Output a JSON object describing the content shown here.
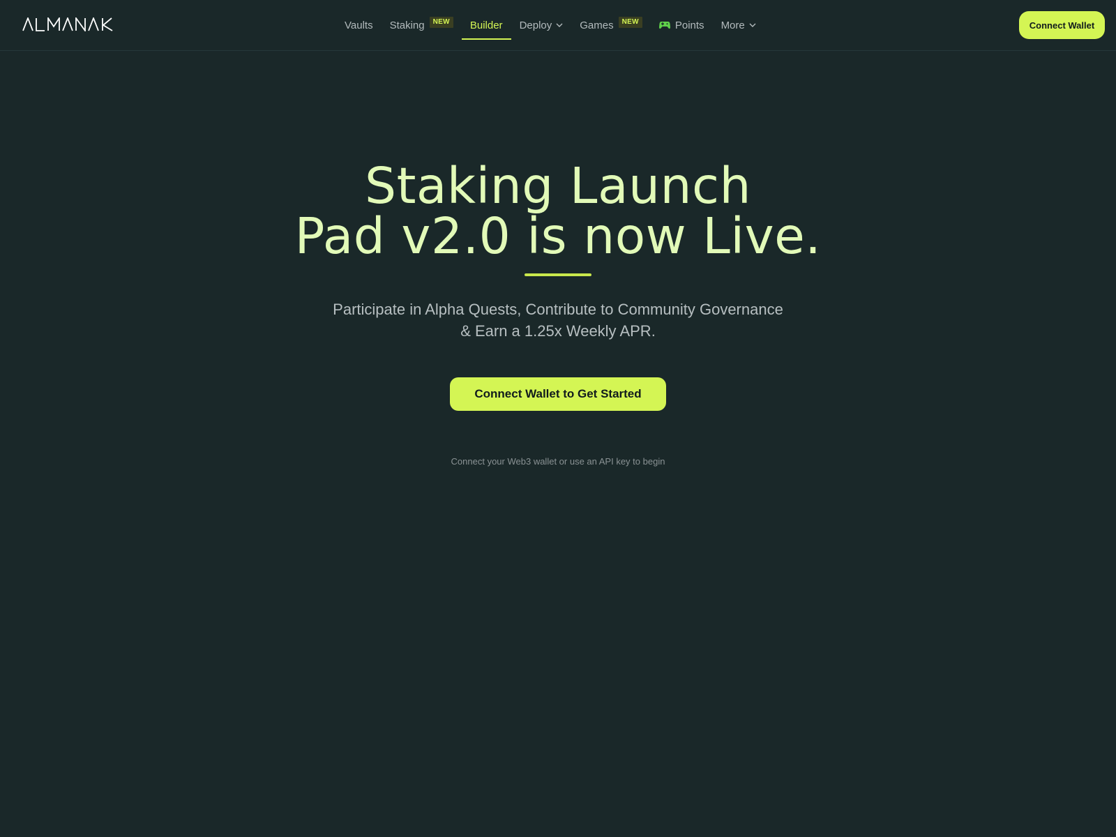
{
  "brand": {
    "logo_text": "ALMANAK",
    "accent_color": "#d4f554",
    "background_color": "#1a2829"
  },
  "nav": {
    "items": [
      {
        "label": "Vaults",
        "active": false
      },
      {
        "label": "Staking",
        "badge": "NEW",
        "active": false
      },
      {
        "label": "Builder",
        "active": true
      },
      {
        "label": "Deploy",
        "icon": "chevron-down-icon",
        "active": false
      },
      {
        "label": "Games",
        "badge": "NEW",
        "active": false
      },
      {
        "label": "Points",
        "icon": "gamepad-icon",
        "active": false
      },
      {
        "label": "More",
        "icon": "chevron-down-icon",
        "active": false
      }
    ],
    "connect_wallet_label": "Connect Wallet"
  },
  "hero": {
    "title_line1": "Staking Launch",
    "title_line2": "Pad v2.0 is now Live.",
    "subtitle_line1": "Participate in Alpha Quests, Contribute to Community Governance",
    "subtitle_line2": "& Earn a 1.25x Weekly APR.",
    "cta_label": "Connect Wallet to Get Started",
    "hint": "Connect your Web3 wallet or use an API key to begin"
  }
}
